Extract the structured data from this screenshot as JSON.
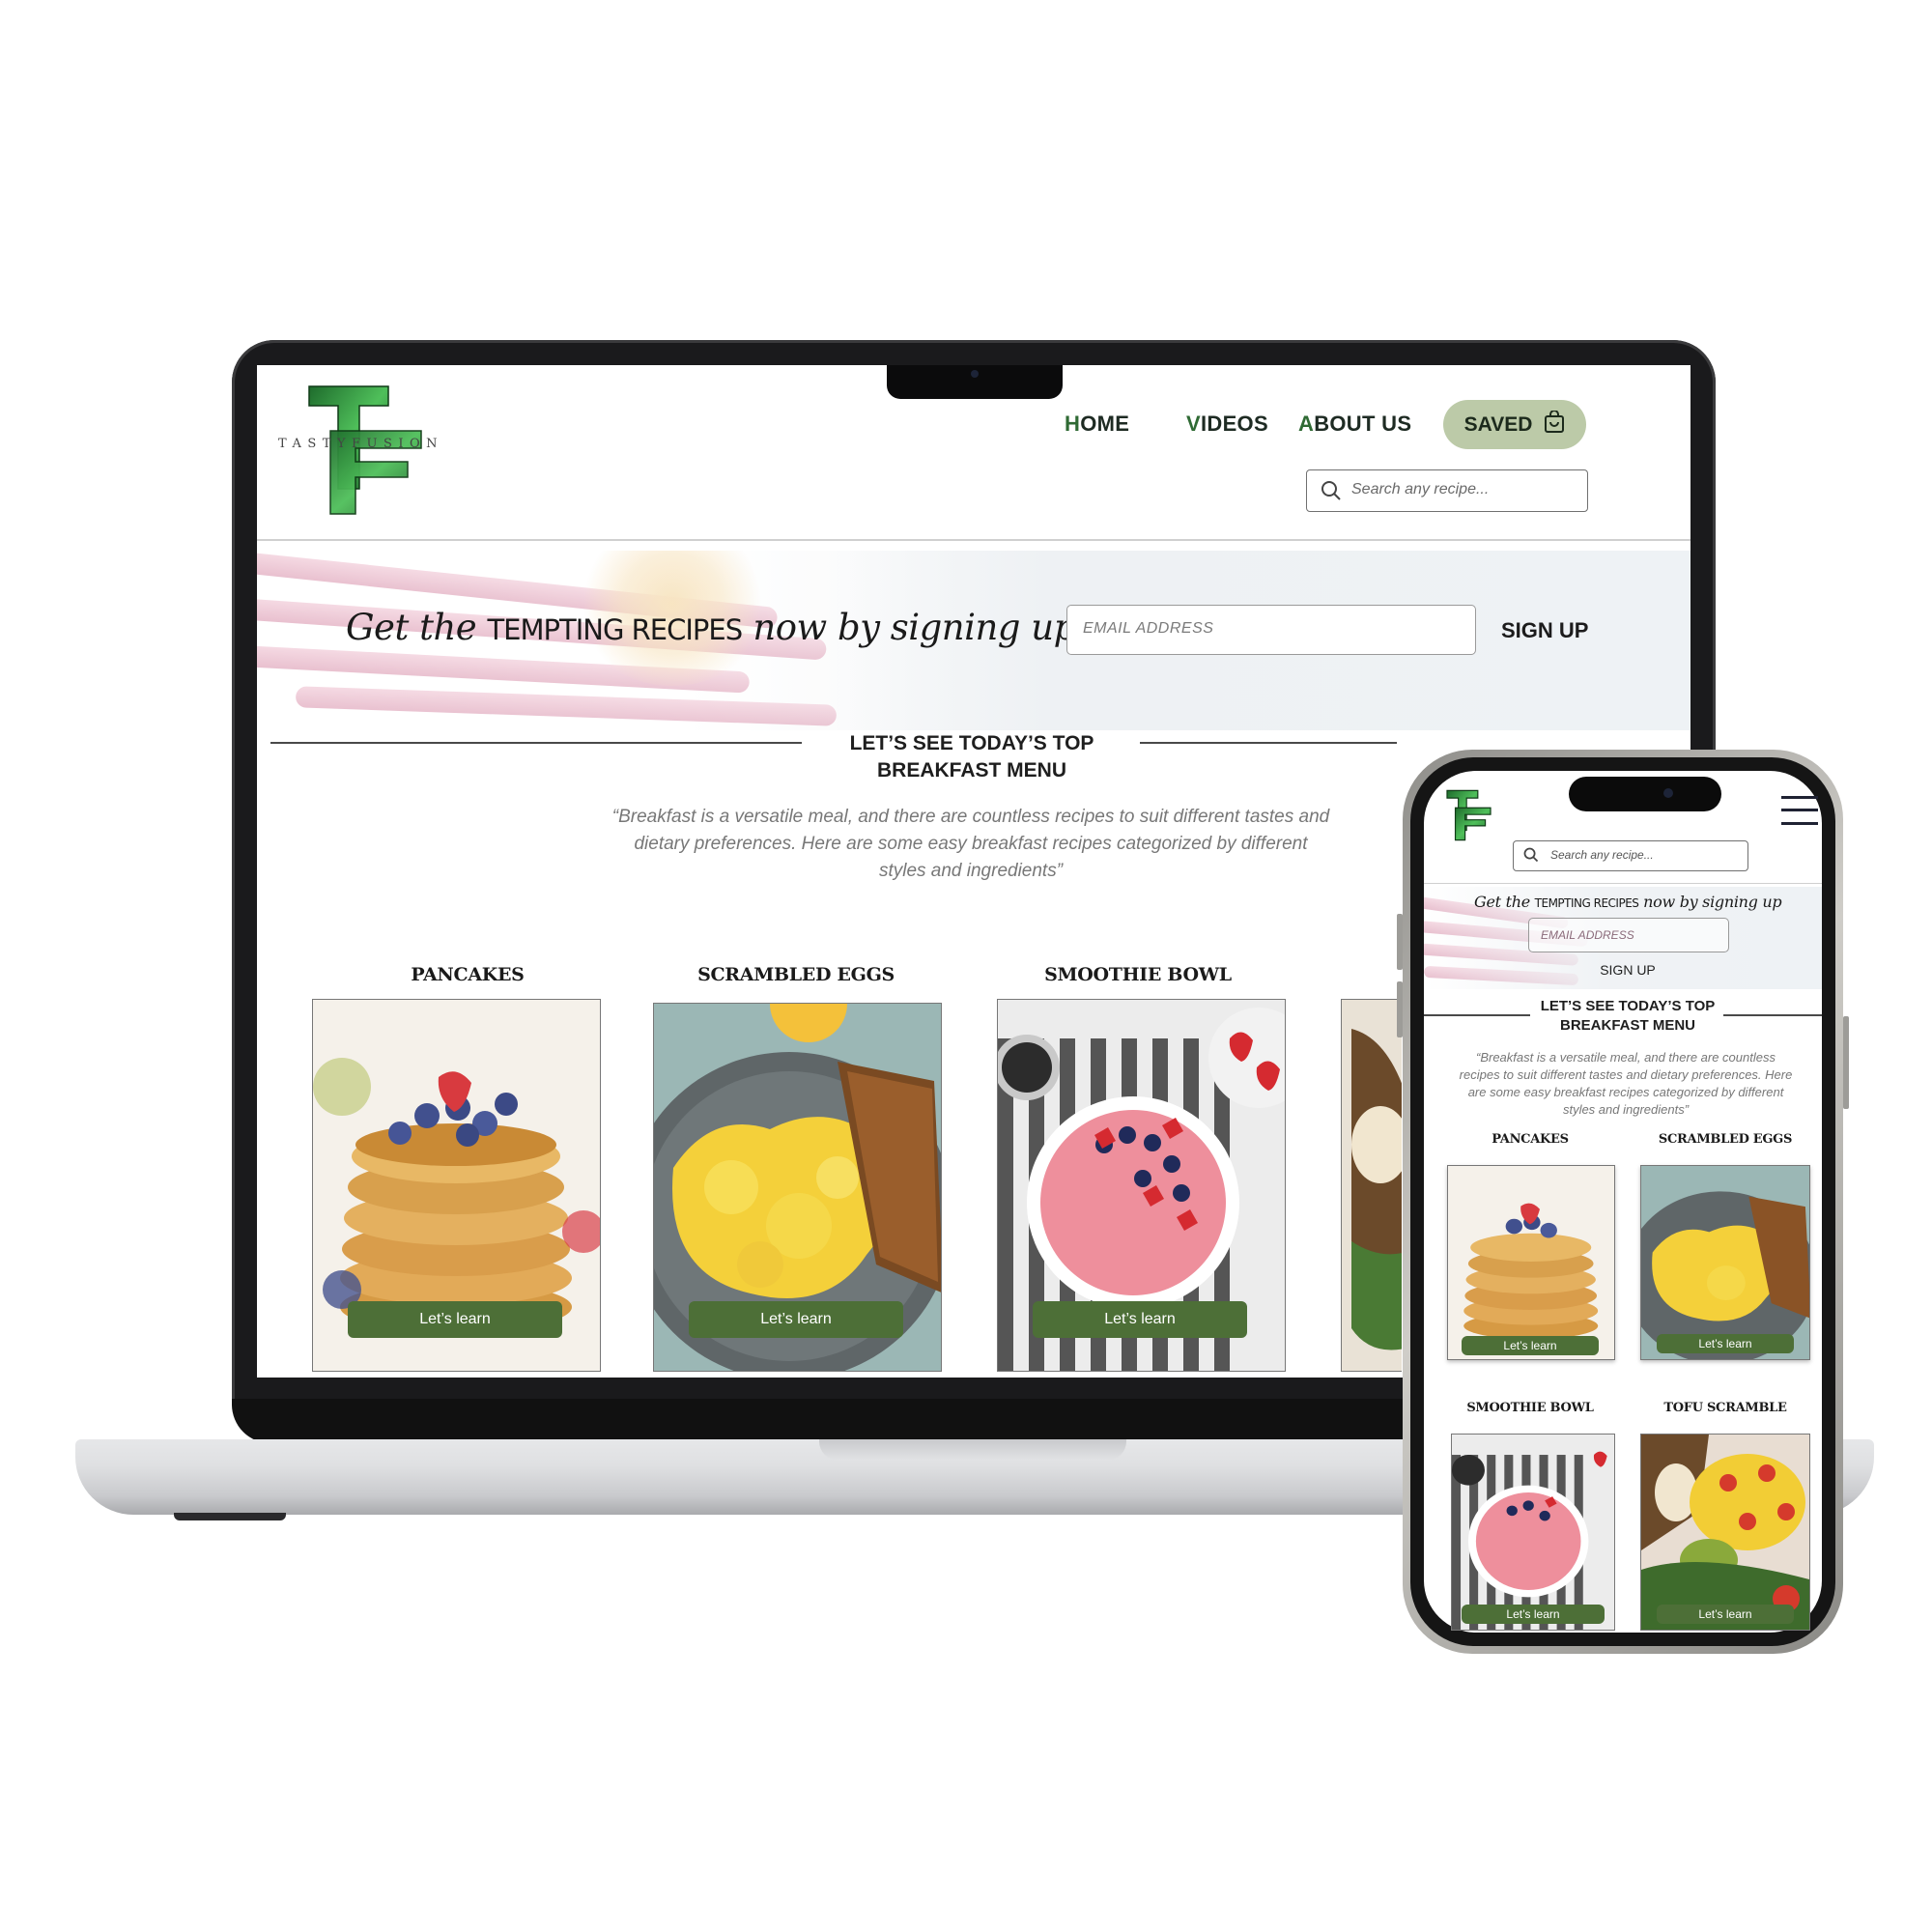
{
  "brand": {
    "mark": "TF",
    "name": "TASTYFUSION",
    "green": "#2f8a3a",
    "accent": "#4d6f37"
  },
  "nav": {
    "items": [
      {
        "first": "H",
        "rest": "OME"
      },
      {
        "first": "V",
        "rest": "IDEOS"
      },
      {
        "first": "A",
        "rest": "BOUT US"
      }
    ],
    "saved_label": "SAVED",
    "saved_icon": "shopping-bag-icon"
  },
  "search": {
    "placeholder": "Search any recipe..."
  },
  "banner": {
    "part1": "Get the ",
    "highlight": "TEMPTING RECIPES",
    "part2": " now by signing up",
    "email_placeholder": "EMAIL ADDRESS",
    "signup_label": "SIGN UP"
  },
  "section": {
    "title_line1": "LET’S SEE TODAY’S TOP",
    "title_line2": "BREAKFAST MENU",
    "quote": "“Breakfast is a versatile meal, and there are countless recipes to suit different tastes and dietary preferences. Here are some easy breakfast recipes categorized by different styles and ingredients”"
  },
  "recipes": [
    {
      "title": "PANCAKES",
      "button": "Let’s learn"
    },
    {
      "title": "SCRAMBLED EGGS",
      "button": "Let’s learn"
    },
    {
      "title": "SMOOTHIE BOWL",
      "button": "Let’s learn"
    },
    {
      "title": "TOFU SCRAMBLE",
      "button": "Let’s learn"
    }
  ]
}
